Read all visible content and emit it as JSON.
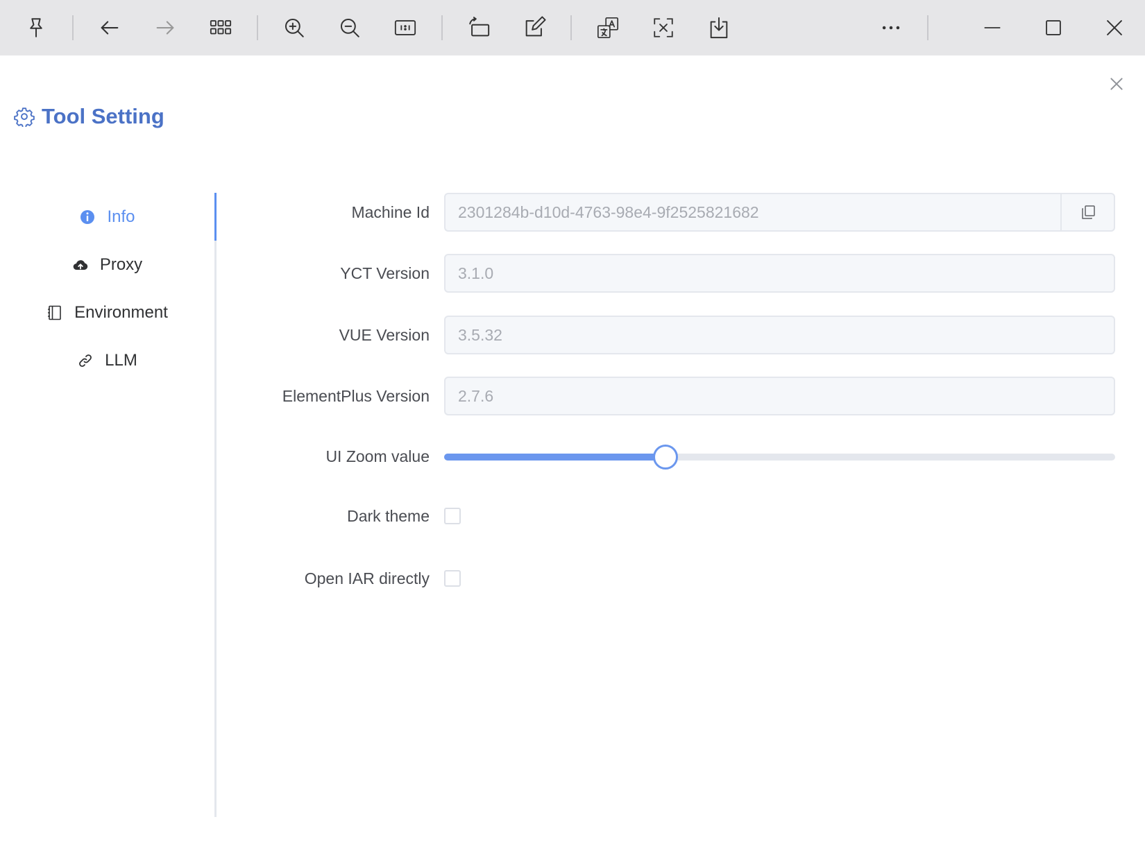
{
  "toolbar": {
    "buttons": [
      {
        "name": "pin-icon"
      },
      {
        "name": "back-arrow-icon"
      },
      {
        "name": "forward-arrow-icon"
      },
      {
        "name": "grid-view-icon"
      },
      {
        "name": "zoom-in-icon"
      },
      {
        "name": "zoom-out-icon"
      },
      {
        "name": "actual-size-icon"
      },
      {
        "name": "rotate-icon"
      },
      {
        "name": "edit-icon"
      },
      {
        "name": "translate-icon"
      },
      {
        "name": "visual-search-icon"
      },
      {
        "name": "save-icon"
      },
      {
        "name": "more-icon"
      },
      {
        "name": "minimize-icon"
      },
      {
        "name": "maximize-icon"
      },
      {
        "name": "close-icon"
      }
    ]
  },
  "dialog": {
    "title": "Tool Setting",
    "title_icon": "gear-icon",
    "accent_color": "#5b8ff0"
  },
  "tabs": [
    {
      "label": "Info",
      "icon": "info-icon",
      "active": true
    },
    {
      "label": "Proxy",
      "icon": "cloud-upload-icon",
      "active": false
    },
    {
      "label": "Environment",
      "icon": "notebook-icon",
      "active": false
    },
    {
      "label": "LLM",
      "icon": "link-icon",
      "active": false
    }
  ],
  "form": {
    "machine_id": {
      "label": "Machine Id",
      "value": "2301284b-d10d-4763-98e4-9f2525821682"
    },
    "yct_version": {
      "label": "YCT Version",
      "value": "3.1.0"
    },
    "vue_version": {
      "label": "VUE Version",
      "value": "3.5.32"
    },
    "elementplus_version": {
      "label": "ElementPlus Version",
      "value": "2.7.6"
    },
    "ui_zoom": {
      "label": "UI Zoom value",
      "percent": 33
    },
    "dark_theme": {
      "label": "Dark theme",
      "checked": false
    },
    "open_iar": {
      "label": "Open IAR directly",
      "checked": false
    }
  }
}
